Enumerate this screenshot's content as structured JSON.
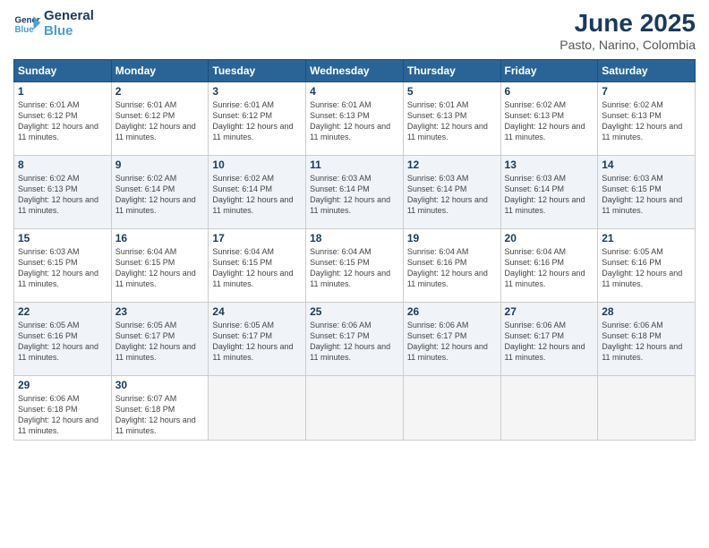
{
  "logo": {
    "line1": "General",
    "line2": "Blue"
  },
  "title": "June 2025",
  "location": "Pasto, Narino, Colombia",
  "weekdays": [
    "Sunday",
    "Monday",
    "Tuesday",
    "Wednesday",
    "Thursday",
    "Friday",
    "Saturday"
  ],
  "days": [
    {
      "date": "1",
      "sunrise": "6:01 AM",
      "sunset": "6:12 PM",
      "daylight": "12 hours and 11 minutes."
    },
    {
      "date": "2",
      "sunrise": "6:01 AM",
      "sunset": "6:12 PM",
      "daylight": "12 hours and 11 minutes."
    },
    {
      "date": "3",
      "sunrise": "6:01 AM",
      "sunset": "6:12 PM",
      "daylight": "12 hours and 11 minutes."
    },
    {
      "date": "4",
      "sunrise": "6:01 AM",
      "sunset": "6:13 PM",
      "daylight": "12 hours and 11 minutes."
    },
    {
      "date": "5",
      "sunrise": "6:01 AM",
      "sunset": "6:13 PM",
      "daylight": "12 hours and 11 minutes."
    },
    {
      "date": "6",
      "sunrise": "6:02 AM",
      "sunset": "6:13 PM",
      "daylight": "12 hours and 11 minutes."
    },
    {
      "date": "7",
      "sunrise": "6:02 AM",
      "sunset": "6:13 PM",
      "daylight": "12 hours and 11 minutes."
    },
    {
      "date": "8",
      "sunrise": "6:02 AM",
      "sunset": "6:13 PM",
      "daylight": "12 hours and 11 minutes."
    },
    {
      "date": "9",
      "sunrise": "6:02 AM",
      "sunset": "6:14 PM",
      "daylight": "12 hours and 11 minutes."
    },
    {
      "date": "10",
      "sunrise": "6:02 AM",
      "sunset": "6:14 PM",
      "daylight": "12 hours and 11 minutes."
    },
    {
      "date": "11",
      "sunrise": "6:03 AM",
      "sunset": "6:14 PM",
      "daylight": "12 hours and 11 minutes."
    },
    {
      "date": "12",
      "sunrise": "6:03 AM",
      "sunset": "6:14 PM",
      "daylight": "12 hours and 11 minutes."
    },
    {
      "date": "13",
      "sunrise": "6:03 AM",
      "sunset": "6:14 PM",
      "daylight": "12 hours and 11 minutes."
    },
    {
      "date": "14",
      "sunrise": "6:03 AM",
      "sunset": "6:15 PM",
      "daylight": "12 hours and 11 minutes."
    },
    {
      "date": "15",
      "sunrise": "6:03 AM",
      "sunset": "6:15 PM",
      "daylight": "12 hours and 11 minutes."
    },
    {
      "date": "16",
      "sunrise": "6:04 AM",
      "sunset": "6:15 PM",
      "daylight": "12 hours and 11 minutes."
    },
    {
      "date": "17",
      "sunrise": "6:04 AM",
      "sunset": "6:15 PM",
      "daylight": "12 hours and 11 minutes."
    },
    {
      "date": "18",
      "sunrise": "6:04 AM",
      "sunset": "6:15 PM",
      "daylight": "12 hours and 11 minutes."
    },
    {
      "date": "19",
      "sunrise": "6:04 AM",
      "sunset": "6:16 PM",
      "daylight": "12 hours and 11 minutes."
    },
    {
      "date": "20",
      "sunrise": "6:04 AM",
      "sunset": "6:16 PM",
      "daylight": "12 hours and 11 minutes."
    },
    {
      "date": "21",
      "sunrise": "6:05 AM",
      "sunset": "6:16 PM",
      "daylight": "12 hours and 11 minutes."
    },
    {
      "date": "22",
      "sunrise": "6:05 AM",
      "sunset": "6:16 PM",
      "daylight": "12 hours and 11 minutes."
    },
    {
      "date": "23",
      "sunrise": "6:05 AM",
      "sunset": "6:17 PM",
      "daylight": "12 hours and 11 minutes."
    },
    {
      "date": "24",
      "sunrise": "6:05 AM",
      "sunset": "6:17 PM",
      "daylight": "12 hours and 11 minutes."
    },
    {
      "date": "25",
      "sunrise": "6:06 AM",
      "sunset": "6:17 PM",
      "daylight": "12 hours and 11 minutes."
    },
    {
      "date": "26",
      "sunrise": "6:06 AM",
      "sunset": "6:17 PM",
      "daylight": "12 hours and 11 minutes."
    },
    {
      "date": "27",
      "sunrise": "6:06 AM",
      "sunset": "6:17 PM",
      "daylight": "12 hours and 11 minutes."
    },
    {
      "date": "28",
      "sunrise": "6:06 AM",
      "sunset": "6:18 PM",
      "daylight": "12 hours and 11 minutes."
    },
    {
      "date": "29",
      "sunrise": "6:06 AM",
      "sunset": "6:18 PM",
      "daylight": "12 hours and 11 minutes."
    },
    {
      "date": "30",
      "sunrise": "6:07 AM",
      "sunset": "6:18 PM",
      "daylight": "12 hours and 11 minutes."
    }
  ]
}
